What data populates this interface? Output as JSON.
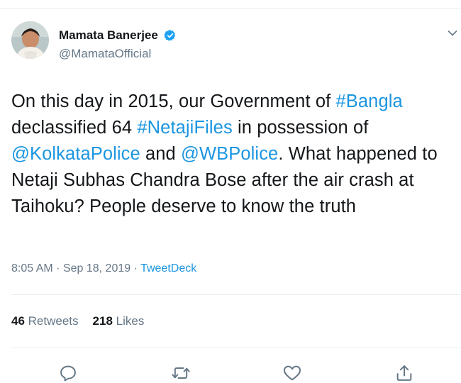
{
  "user": {
    "display_name": "Mamata Banerjee",
    "handle": "@MamataOfficial",
    "verified": true
  },
  "tweet": {
    "segments": [
      {
        "text": "On this day in 2015, our Government of ",
        "link": false
      },
      {
        "text": "#Bangla",
        "link": true
      },
      {
        "text": " declassified 64 ",
        "link": false
      },
      {
        "text": "#NetajiFiles",
        "link": true
      },
      {
        "text": " in possession of ",
        "link": false
      },
      {
        "text": "@KolkataPolice",
        "link": true
      },
      {
        "text": " and ",
        "link": false
      },
      {
        "text": "@WBPolice",
        "link": true
      },
      {
        "text": ". What happened to Netaji Subhas Chandra Bose after the air crash at Taihoku? People deserve to know the truth",
        "link": false
      }
    ],
    "time": "8:05 AM",
    "separator": "·",
    "date": "Sep 18, 2019",
    "source": "TweetDeck"
  },
  "stats": {
    "retweets_count": "46",
    "retweets_label": "Retweets",
    "likes_count": "218",
    "likes_label": "Likes"
  },
  "colors": {
    "link": "#1b95e0",
    "secondary_text": "#657786",
    "verified_badge": "#1da1f2"
  },
  "icons": [
    "reply-icon",
    "retweet-icon",
    "like-icon",
    "share-icon",
    "chevron-down-icon",
    "verified-badge-icon"
  ]
}
